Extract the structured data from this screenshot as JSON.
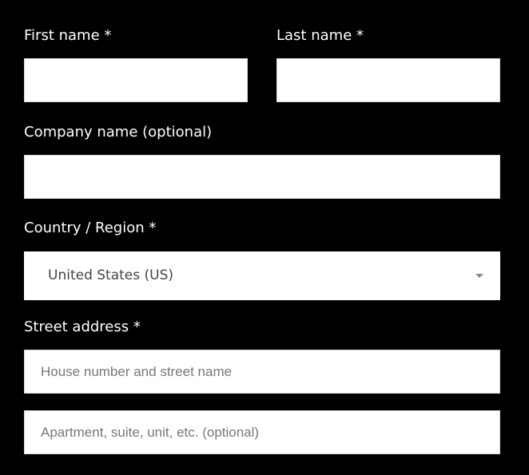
{
  "form": {
    "first_name_label": "First name *",
    "last_name_label": "Last name *",
    "company_label": "Company name (optional)",
    "country_label": "Country / Region *",
    "country_value": "United States (US)",
    "street_label": "Street address *",
    "street_placeholder": "House number and street name",
    "apartment_placeholder": "Apartment, suite, unit, etc. (optional)"
  },
  "colors": {
    "background": "#000000",
    "label_text": "#ffffff",
    "field_background": "#ffffff",
    "placeholder_text": "#777777",
    "select_text": "#444444",
    "select_arrow": "#888888"
  },
  "icons": {
    "country_select_arrow": "chevron-down-icon"
  }
}
